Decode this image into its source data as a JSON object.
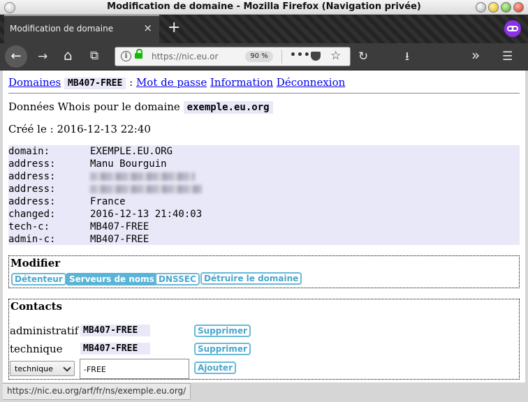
{
  "window": {
    "title": "Modification de domaine - Mozilla Firefox (Navigation privée)"
  },
  "tab": {
    "label": "Modification de domaine",
    "close_glyph": "×",
    "new_tab_glyph": "+"
  },
  "navbar": {
    "back_glyph": "←",
    "forward_glyph": "→",
    "home_glyph": "⌂",
    "url": "https://nic.eu.org",
    "zoom": "90 %",
    "dots": "•••",
    "star_glyph": "☆",
    "reload_glyph": "↻",
    "download_glyph": "⭳",
    "overflow_glyph": "»",
    "menu_glyph": "☰"
  },
  "topnav": {
    "domaines": "Domaines",
    "handle": "MB407-FREE",
    "separator": ":",
    "mot_de_passe": "Mot de passe",
    "information": "Information",
    "deconnexion": "Déconnexion"
  },
  "whois": {
    "intro": "Données Whois pour le domaine",
    "domain": "exemple.eu.org",
    "created_label": "Créé le :",
    "created_value": "2016-12-13 22:40",
    "rows": [
      {
        "key": "domain:",
        "value": "EXEMPLE.EU.ORG"
      },
      {
        "key": "address:",
        "value": "Manu Bourguin"
      },
      {
        "key": "address:",
        "value": ""
      },
      {
        "key": "address:",
        "value": ""
      },
      {
        "key": "address:",
        "value": "France"
      },
      {
        "key": "changed:",
        "value": "2016-12-13 21:40:03"
      },
      {
        "key": "tech-c:",
        "value": "MB407-FREE"
      },
      {
        "key": "admin-c:",
        "value": "MB407-FREE"
      }
    ]
  },
  "modifier": {
    "title": "Modifier",
    "buttons": [
      "Détenteur",
      "Serveurs de noms",
      "DNSSEC",
      "Détruire le domaine"
    ]
  },
  "contacts": {
    "title": "Contacts",
    "rows": [
      {
        "label": "administratif",
        "handle": "MB407-FREE",
        "action": "Supprimer"
      },
      {
        "label": "technique",
        "handle": "MB407-FREE",
        "action": "Supprimer"
      }
    ],
    "type_select": "technique",
    "handle_input": "-FREE",
    "add_button": "Ajouter"
  },
  "statusbar": {
    "text": "https://nic.eu.org/arf/fr/ns/exemple.eu.org/"
  },
  "colors": {
    "link": "#0000ee",
    "pill": "#4aa7cc",
    "private": "#8c31e6",
    "lock": "#12bc00"
  }
}
